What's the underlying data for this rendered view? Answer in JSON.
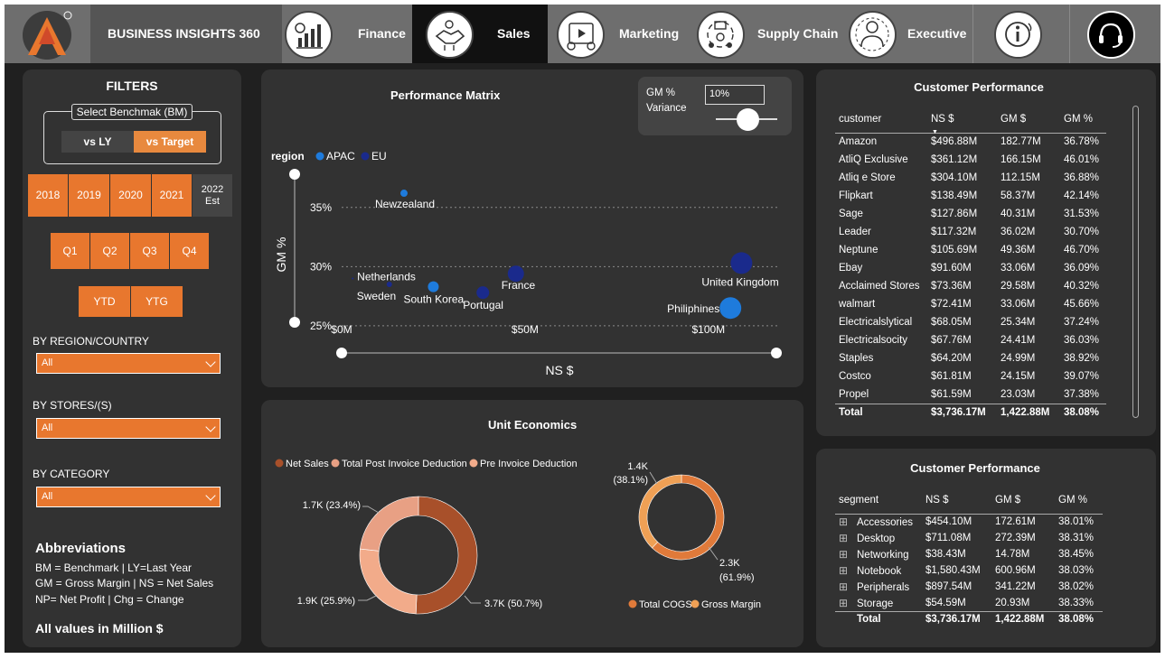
{
  "nav": {
    "brand": "BUSINESS INSIGHTS 360",
    "tabs": [
      {
        "label": "Finance",
        "icon": "finance-chart-icon"
      },
      {
        "label": "Sales",
        "icon": "handshake-icon"
      },
      {
        "label": "Marketing",
        "icon": "marketing-icon"
      },
      {
        "label": "Supply Chain",
        "icon": "supply-chain-icon"
      },
      {
        "label": "Executive",
        "icon": "executive-icon"
      }
    ],
    "info_icon": "info-icon",
    "support_icon": "support-headset-icon",
    "logo_icon": "company-logo-icon",
    "active_tab": "Sales"
  },
  "filters": {
    "title": "FILTERS",
    "benchmark_label": "Select Benchmak (BM)",
    "benchmark_options": [
      "vs LY",
      "vs Target"
    ],
    "years": [
      "2018",
      "2019",
      "2020",
      "2021"
    ],
    "year_est_top": "2022",
    "year_est_bottom": "Est",
    "quarters": [
      "Q1",
      "Q2",
      "Q3",
      "Q4"
    ],
    "periods": [
      "YTD",
      "YTG"
    ],
    "region_label": "BY REGION/COUNTRY",
    "region_value": "All",
    "stores_label": "BY STORES/(S)",
    "stores_value": "All",
    "category_label": "BY CATEGORY",
    "category_value": "All",
    "abbr_title": "Abbreviations",
    "abbr_lines": [
      "BM = Benchmark | LY=Last Year",
      "GM = Gross Margin | NS = Net Sales",
      "NP= Net Profit | Chg = Change"
    ],
    "units_note": "All values in Million $"
  },
  "perf_matrix": {
    "title": "Performance Matrix",
    "gm_label": "GM %",
    "variance_label": "Variance",
    "variance_value": "10%",
    "legend_title": "region",
    "colors": {
      "APAC": "#1e7bdc",
      "EU": "#1a2a8c",
      "accent": "#e8772e"
    }
  },
  "chart_data": [
    {
      "type": "scatter",
      "title": "Performance Matrix",
      "xlabel": "NS $",
      "ylabel": "GM %",
      "x_ticks": [
        "$0M",
        "$50M",
        "$100M"
      ],
      "y_ticks": [
        "25%",
        "30%",
        "35%"
      ],
      "xlim": [
        0,
        120
      ],
      "ylim": [
        24,
        37.5
      ],
      "legend": [
        "APAC",
        "EU"
      ],
      "points": [
        {
          "label": "Newzealand",
          "region": "APAC",
          "x": 17,
          "y": 36.2,
          "size": 4
        },
        {
          "label": "Netherlands",
          "region": "EU",
          "x": 3,
          "y": 29,
          "size": 1
        },
        {
          "label": "Sweden",
          "region": "EU",
          "x": 13,
          "y": 28.5,
          "size": 3
        },
        {
          "label": "South Korea",
          "region": "APAC",
          "x": 25,
          "y": 28.3,
          "size": 6
        },
        {
          "label": "Portugal",
          "region": "EU",
          "x": 38.5,
          "y": 27.8,
          "size": 7
        },
        {
          "label": "France",
          "region": "EU",
          "x": 47.5,
          "y": 29.4,
          "size": 9
        },
        {
          "label": "United Kingdom",
          "region": "EU",
          "x": 109,
          "y": 30.3,
          "size": 12
        },
        {
          "label": "Philiphines",
          "region": "APAC",
          "x": 106,
          "y": 26.5,
          "size": 12
        }
      ]
    },
    {
      "type": "pie",
      "title": "Unit Economics",
      "legend": [
        "Net Sales",
        "Total Post Invoice Deduction",
        "Pre Invoice Deduction"
      ],
      "slices": [
        {
          "name": "Net Sales",
          "value": 3.7,
          "label": "3.7K (50.7%)",
          "color": "#a8502a"
        },
        {
          "name": "Pre Invoice Deduction",
          "value": 1.9,
          "label": "1.9K (25.9%)",
          "color": "#f2ab8a"
        },
        {
          "name": "Total Post Invoice Deduction",
          "value": 1.7,
          "label": "1.7K (23.4%)",
          "color": "#e8a084"
        }
      ]
    },
    {
      "type": "pie",
      "legend": [
        "Total COGS",
        "Gross Margin"
      ],
      "slices": [
        {
          "name": "Total COGS",
          "value": 2.3,
          "label_top": "2.3K",
          "label_bottom": "(61.9%)",
          "color": "#e07a3a"
        },
        {
          "name": "Gross Margin",
          "value": 1.4,
          "label_top": "1.4K",
          "label_bottom": "(38.1%)",
          "color": "#efa055"
        }
      ]
    }
  ],
  "unit_economics": {
    "title": "Unit Economics",
    "legend": [
      {
        "label": "Net Sales",
        "color": "#a8502a"
      },
      {
        "label": "Total Post Invoice Deduction",
        "color": "#e8a084"
      },
      {
        "label": "Pre Invoice Deduction",
        "color": "#f2ab8a"
      }
    ],
    "legend2": [
      {
        "label": "Total COGS",
        "color": "#e07a3a"
      },
      {
        "label": "Gross Margin",
        "color": "#efa055"
      }
    ]
  },
  "customer_perf": {
    "title": "Customer Performance",
    "headers": [
      "customer",
      "NS $",
      "GM $",
      "GM %"
    ],
    "rows": [
      [
        "Amazon",
        "$496.88M",
        "182.77M",
        "36.78%"
      ],
      [
        "AtliQ Exclusive",
        "$361.12M",
        "166.15M",
        "46.01%"
      ],
      [
        "Atliq e Store",
        "$304.10M",
        "112.15M",
        "36.88%"
      ],
      [
        "Flipkart",
        "$138.49M",
        "58.37M",
        "42.14%"
      ],
      [
        "Sage",
        "$127.86M",
        "40.31M",
        "31.53%"
      ],
      [
        "Leader",
        "$117.32M",
        "36.02M",
        "30.70%"
      ],
      [
        "Neptune",
        "$105.69M",
        "49.36M",
        "46.70%"
      ],
      [
        "Ebay",
        "$91.60M",
        "33.06M",
        "36.09%"
      ],
      [
        "Acclaimed Stores",
        "$73.36M",
        "29.58M",
        "40.32%"
      ],
      [
        "walmart",
        "$72.41M",
        "33.06M",
        "45.66%"
      ],
      [
        "Electricalslytical",
        "$68.05M",
        "25.34M",
        "37.24%"
      ],
      [
        "Electricalsocity",
        "$67.76M",
        "24.41M",
        "36.03%"
      ],
      [
        "Staples",
        "$64.20M",
        "24.99M",
        "38.92%"
      ],
      [
        "Costco",
        "$61.81M",
        "24.15M",
        "39.07%"
      ],
      [
        "Propel",
        "$61.59M",
        "23.03M",
        "37.38%"
      ]
    ],
    "total": [
      "Total",
      "$3,736.17M",
      "1,422.88M",
      "38.08%"
    ]
  },
  "segment_perf": {
    "title": "Customer Performance",
    "headers": [
      "segment",
      "NS $",
      "GM $",
      "GM %"
    ],
    "rows": [
      [
        "Accessories",
        "$454.10M",
        "172.61M",
        "38.01%"
      ],
      [
        "Desktop",
        "$711.08M",
        "272.39M",
        "38.31%"
      ],
      [
        "Networking",
        "$38.43M",
        "14.78M",
        "38.45%"
      ],
      [
        "Notebook",
        "$1,580.43M",
        "600.96M",
        "38.03%"
      ],
      [
        "Peripherals",
        "$897.54M",
        "341.22M",
        "38.02%"
      ],
      [
        "Storage",
        "$54.59M",
        "20.93M",
        "38.33%"
      ]
    ],
    "total": [
      "Total",
      "$3,736.17M",
      "1,422.88M",
      "38.08%"
    ]
  }
}
